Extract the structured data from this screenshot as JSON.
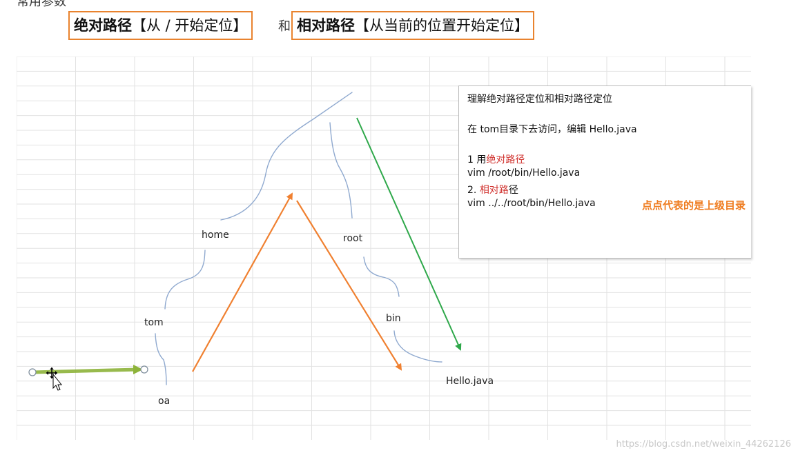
{
  "top_fragment": "常用参数",
  "heading": {
    "absolute_bold": "绝对路径",
    "absolute_rest": "【从 / 开始定位】",
    "and": "和",
    "relative_bold": "相对路径",
    "relative_rest": "【从当前的位置开始定位】"
  },
  "tree": {
    "home": "home",
    "root": "root",
    "tom": "tom",
    "bin": "bin",
    "oa": "oa",
    "hello": "Hello.java"
  },
  "note": {
    "title": "理解绝对路径定位和相对路径定位",
    "task": "在 tom目录下去访问，编辑 Hello.java",
    "item1_prefix": "1 用",
    "item1_highlight": "绝对路径",
    "item1_cmd": "vim /root/bin/Hello.java",
    "item2_prefix": "2. ",
    "item2_highlight": "相对路",
    "item2_suffix": "径",
    "item2_cmd": "vim ../../root/bin/Hello.java",
    "dots_note": "点点代表的是上级目录"
  },
  "watermark": "https://blog.csdn.net/weixin_44262126",
  "colors": {
    "box_border": "#e9832e",
    "orange_arrow": "#f08030",
    "green_arrow": "#2ea84a",
    "cursor_arrow": "#8db33a",
    "tree_line": "#8fa9cf",
    "highlight_red": "#d0312d"
  }
}
